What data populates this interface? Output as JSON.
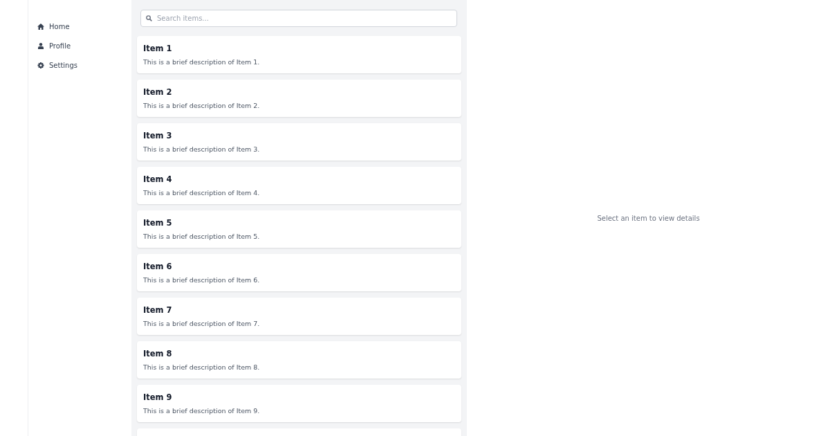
{
  "sidebar": {
    "items": [
      {
        "label": "Home"
      },
      {
        "label": "Profile"
      },
      {
        "label": "Settings"
      }
    ]
  },
  "search": {
    "placeholder": "Search items..."
  },
  "list": {
    "items": [
      {
        "title": "Item 1",
        "description": "This is a brief description of Item 1."
      },
      {
        "title": "Item 2",
        "description": "This is a brief description of Item 2."
      },
      {
        "title": "Item 3",
        "description": "This is a brief description of Item 3."
      },
      {
        "title": "Item 4",
        "description": "This is a brief description of Item 4."
      },
      {
        "title": "Item 5",
        "description": "This is a brief description of Item 5."
      },
      {
        "title": "Item 6",
        "description": "This is a brief description of Item 6."
      },
      {
        "title": "Item 7",
        "description": "This is a brief description of Item 7."
      },
      {
        "title": "Item 8",
        "description": "This is a brief description of Item 8."
      },
      {
        "title": "Item 9",
        "description": "This is a brief description of Item 9."
      }
    ],
    "more_below": true
  },
  "detail": {
    "empty_message": "Select an item to view details"
  }
}
